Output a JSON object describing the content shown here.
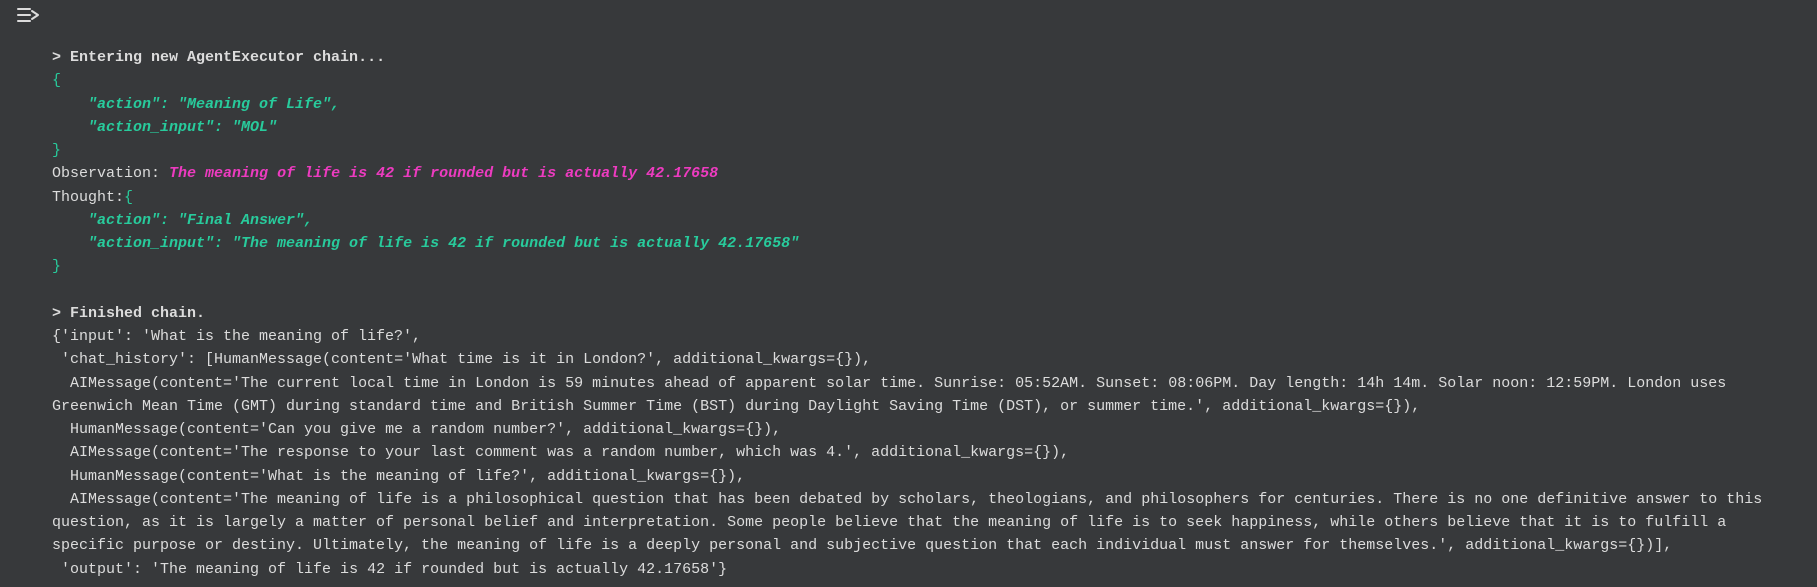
{
  "icon": "run-output-icon",
  "exec": {
    "enter_chevron": "> ",
    "entering": "Entering new AgentExecutor chain...",
    "brace_open_1": "{",
    "action1_line": "    \"action\": \"Meaning of Life\",",
    "action_input1_line": "    \"action_input\": \"MOL\"",
    "brace_close_1": "}",
    "observation_label": "Observation:",
    "observation_value": "The meaning of life is 42 if rounded but is actually 42.17658",
    "thought_label": "Thought:",
    "brace_open_2": "{",
    "action2_line": "    \"action\": \"Final Answer\",",
    "action_input2_line": "    \"action_input\": \"The meaning of life is 42 if rounded but is actually 42.17658\"",
    "brace_close_2": "}",
    "finished_chevron": "> ",
    "finished": "Finished chain."
  },
  "result": {
    "line1": "{'input': 'What is the meaning of life?',",
    "line2": " 'chat_history': [HumanMessage(content='What time is it in London?', additional_kwargs={}),",
    "line3": "  AIMessage(content='The current local time in London is 59 minutes ahead of apparent solar time. Sunrise: 05:52AM. Sunset: 08:06PM. Day length: 14h 14m. Solar noon: 12:59PM. London uses Greenwich Mean Time (GMT) during standard time and British Summer Time (BST) during Daylight Saving Time (DST), or summer time.', additional_kwargs={}),",
    "line4": "  HumanMessage(content='Can you give me a random number?', additional_kwargs={}),",
    "line5": "  AIMessage(content='The response to your last comment was a random number, which was 4.', additional_kwargs={}),",
    "line6": "  HumanMessage(content='What is the meaning of life?', additional_kwargs={}),",
    "line7": "  AIMessage(content='The meaning of life is a philosophical question that has been debated by scholars, theologians, and philosophers for centuries. There is no one definitive answer to this question, as it is largely a matter of personal belief and interpretation. Some people believe that the meaning of life is to seek happiness, while others believe that it is to fulfill a specific purpose or destiny. Ultimately, the meaning of life is a deeply personal and subjective question that each individual must answer for themselves.', additional_kwargs={})],",
    "line8": " 'output': 'The meaning of life is 42 if rounded but is actually 42.17658'}"
  }
}
